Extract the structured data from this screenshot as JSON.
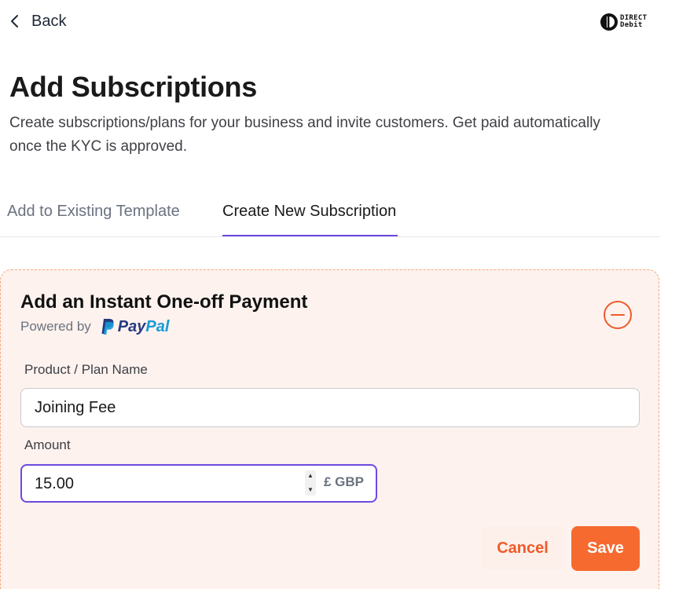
{
  "nav": {
    "back_label": "Back"
  },
  "logo": {
    "line1": "DIRECT",
    "line2": "Debit"
  },
  "page": {
    "title": "Add Subscriptions",
    "subtitle": "Create subscriptions/plans for your business and invite customers. Get paid automatically once the KYC is approved."
  },
  "tabs": [
    {
      "label": "Add to Existing Template",
      "active": false
    },
    {
      "label": "Create New Subscription",
      "active": true
    }
  ],
  "card": {
    "title": "Add an Instant One-off Payment",
    "powered_by": "Powered by",
    "paypal_pay": "Pay",
    "paypal_pal": "Pal",
    "name_label": "Product / Plan Name",
    "name_value": "Joining Fee",
    "amount_label": "Amount",
    "amount_value": "15.00",
    "currency": "£ GBP",
    "cancel_label": "Cancel",
    "save_label": "Save"
  },
  "colors": {
    "accent": "#6d4ae0",
    "brand_orange": "#f66a30",
    "card_bg": "#fdf2ee",
    "paypal_dark": "#253b80",
    "paypal_light": "#179bd7"
  },
  "icons": {
    "back": "chevron-left-icon",
    "remove": "minus-circle-icon",
    "paypal": "paypal-logo-icon",
    "stepper_up": "caret-up-icon",
    "stepper_down": "caret-down-icon"
  }
}
